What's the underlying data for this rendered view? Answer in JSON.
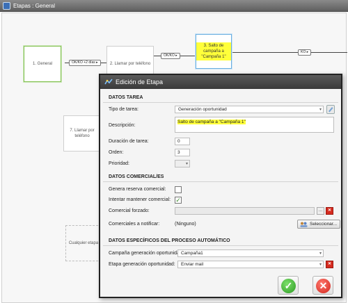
{
  "window": {
    "title": "Etapas : General"
  },
  "canvas": {
    "nodes": {
      "n1": "1. General",
      "n2": "2. Llamar por teléfono",
      "n3": "3. Salto de campaña a \"Campaña 1\"",
      "n7": "7. Llamar por teléfono",
      "any": "Cualquier etapa"
    },
    "edges": {
      "e12": "OK/KO +2 días ▸",
      "e23": "OK/KO ▸",
      "e3r": "KO ▸"
    }
  },
  "dialog": {
    "title": "Edición de Etapa",
    "sections": {
      "datos_tarea": "DATOS TAREA",
      "datos_comercial": "DATOS COMERCIAL/ES",
      "datos_especificos": "DATOS ESPECÍFICOS DEL PROCESO AUTOMÁTICO"
    },
    "fields": {
      "tipo_label": "Tipo de tarea:",
      "tipo_value": "Generación oportunidad",
      "descripcion_label": "Descripción:",
      "descripcion_value": "Salto de campaña a \"Campaña 1\"",
      "duracion_label": "Duración de tarea:",
      "duracion_value": "0",
      "orden_label": "Orden:",
      "orden_value": "3",
      "prioridad_label": "Prioridad:",
      "prioridad_value": "",
      "reserva_label": "Genera reserva comercial:",
      "reserva_checked": false,
      "mantener_label": "Intentar mantener comercial:",
      "mantener_checked": true,
      "forzado_label": "Comercial forzado:",
      "forzado_value": "",
      "notificar_label": "Comerciales a notificar:",
      "notificar_value": "(Ninguno)",
      "seleccionar_button": "Seleccionar...",
      "campana_label": "Campaña generación oportunidad:",
      "campana_value": "Campaña1",
      "etapa_label": "Etapa generación oportunidad:",
      "etapa_value": "Enviar mail"
    },
    "buttons": {
      "ok": "✓",
      "cancel": "✕"
    }
  },
  "colors": {
    "highlight": "#ffff3a",
    "ok": "#2e9a24",
    "cancel": "#d1241a"
  }
}
